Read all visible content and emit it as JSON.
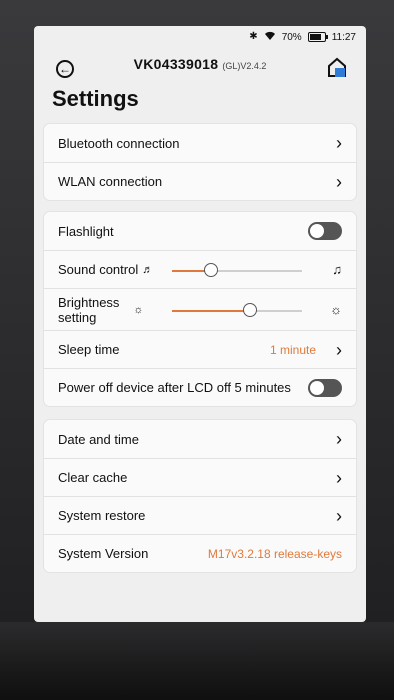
{
  "status": {
    "battery": "70%",
    "time": "11:27",
    "icons": [
      "bluetooth-icon",
      "wifi-icon",
      "battery-icon"
    ]
  },
  "header": {
    "serial": "VK04339018",
    "version": "(GL)V2.4.2",
    "title": "Settings"
  },
  "connections": {
    "bluetooth": "Bluetooth connection",
    "wlan": "WLAN connection"
  },
  "device": {
    "flashlight": "Flashlight",
    "flashlight_on": false,
    "sound_label": "Sound control",
    "sound_level": 0.3,
    "brightness_label_1": "Brightness",
    "brightness_label_2": "setting",
    "brightness_level": 0.6,
    "sleep_label": "Sleep time",
    "sleep_value": "1 minute",
    "poweroff_label": "Power off device after LCD off 5 minutes",
    "poweroff_on": false
  },
  "system": {
    "date_time": "Date and time",
    "clear_cache": "Clear cache",
    "restore": "System restore",
    "version_label": "System Version",
    "version_value": "M17v3.2.18 release-keys"
  },
  "colors": {
    "accent": "#e07a3c",
    "toggle_off": "#555555",
    "card": "#fafafa",
    "screen": "#efefef"
  }
}
